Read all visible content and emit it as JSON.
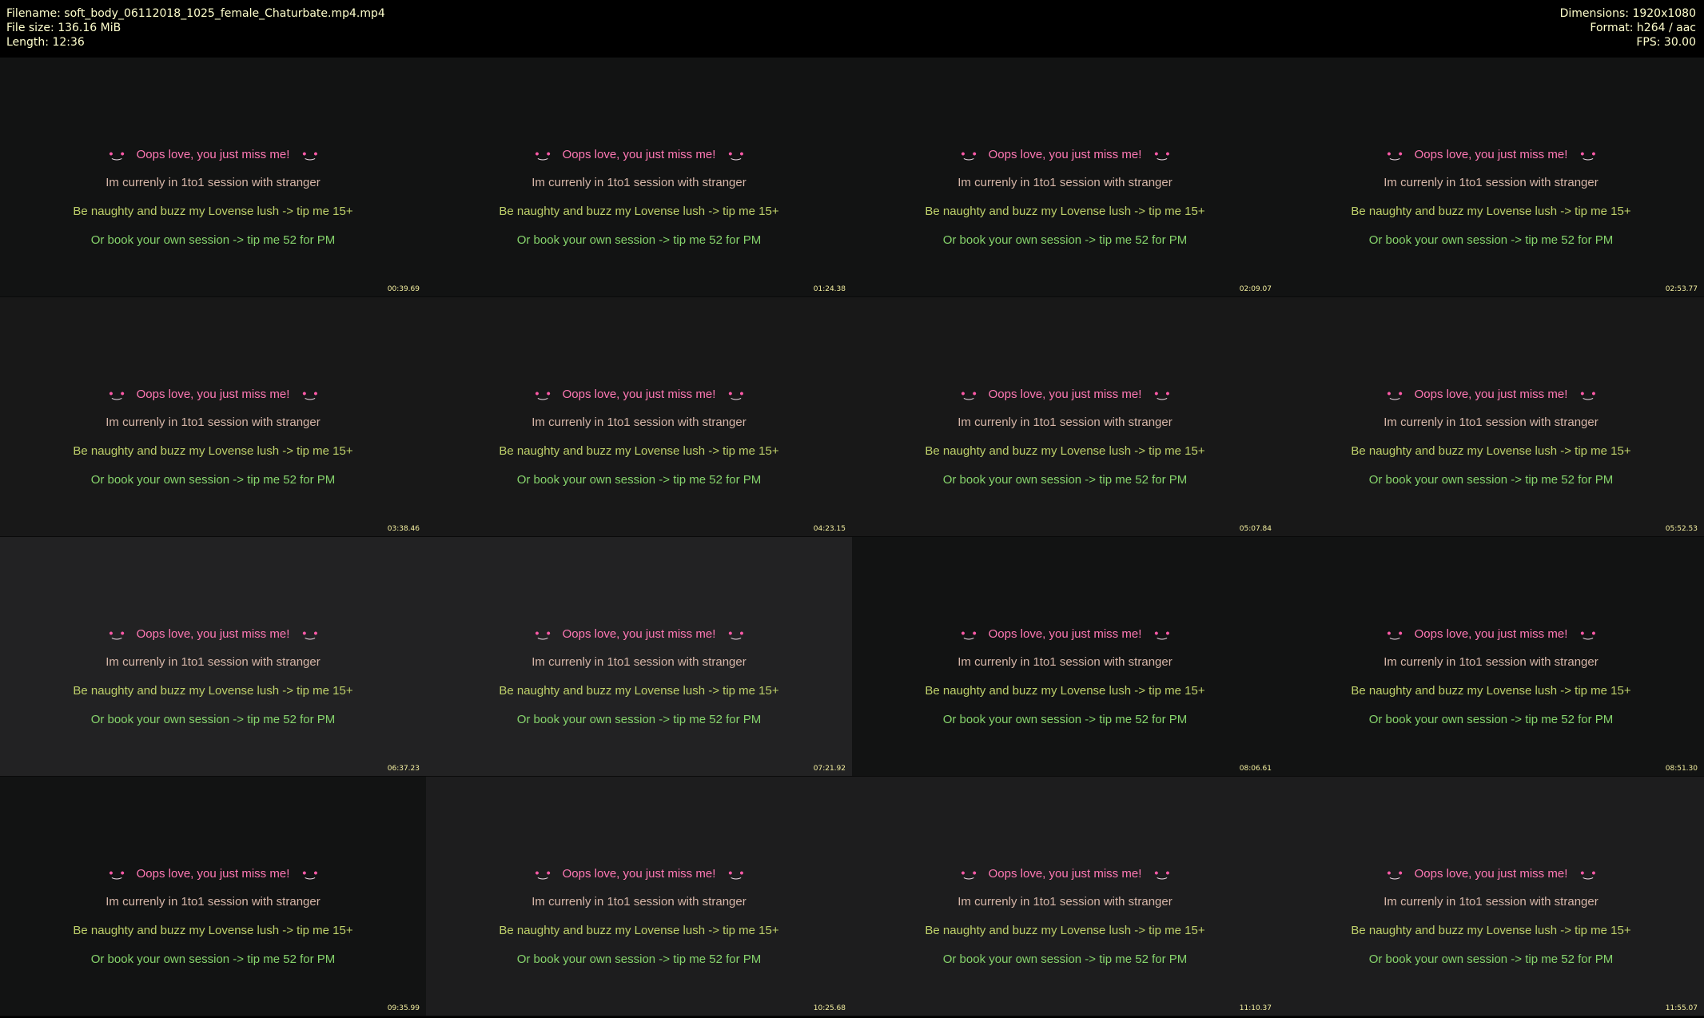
{
  "header": {
    "filename": "Filename: soft_body_06112018_1025_female_Chaturbate.mp4.mp4",
    "filesize": "File size: 136.16 MiB",
    "length": "Length: 12:36",
    "dimensions": "Dimensions: 1920x1080",
    "format": "Format: h264 / aac",
    "fps": "FPS: 30.00"
  },
  "thumbnail_text": {
    "line1": "Oops love, you just miss me!",
    "line2": "Im currenly in 1to1 session with stranger",
    "line3": "Be naughty and buzz my Lovense lush -> tip me 15+",
    "line4": "Or book your own session -> tip me 52 for PM"
  },
  "thumbnails": [
    {
      "timestamp": "00:39.69"
    },
    {
      "timestamp": "01:24.38"
    },
    {
      "timestamp": "02:09.07"
    },
    {
      "timestamp": "02:53.77"
    },
    {
      "timestamp": "03:38.46"
    },
    {
      "timestamp": "04:23.15"
    },
    {
      "timestamp": "05:07.84"
    },
    {
      "timestamp": "05:52.53"
    },
    {
      "timestamp": "06:37.23"
    },
    {
      "timestamp": "07:21.92"
    },
    {
      "timestamp": "08:06.61"
    },
    {
      "timestamp": "08:51.30"
    },
    {
      "timestamp": "09:35.99"
    },
    {
      "timestamp": "10:25.68"
    },
    {
      "timestamp": "11:10.37"
    },
    {
      "timestamp": "11:55.07"
    }
  ],
  "colors": {
    "header_text": "#ffffcc",
    "line1": "#ff78b4",
    "line2": "#d6b6a8",
    "line3": "#bed06a",
    "line4": "#86d46c",
    "timestamp": "#f5f0a0"
  },
  "icons": {
    "emote": "blushing-face-icon"
  }
}
